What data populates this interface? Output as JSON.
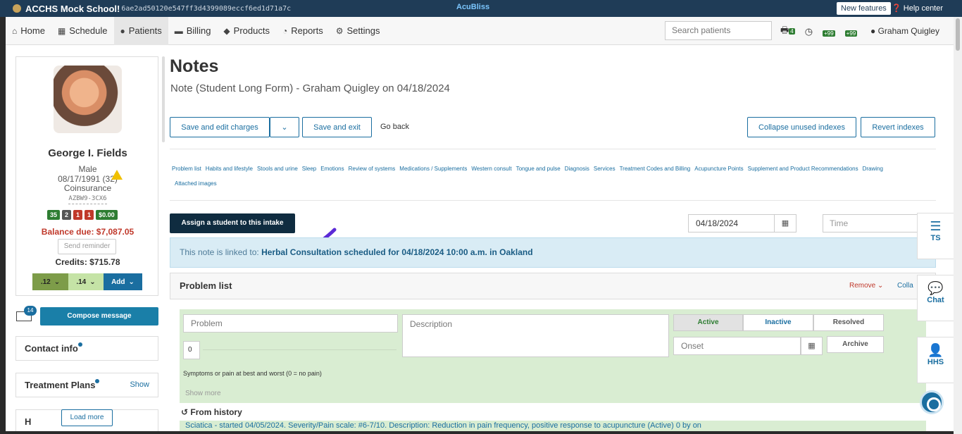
{
  "topbar": {
    "school": "ACCHS Mock School!",
    "hash": "6ae2ad50120e547ff3d4399089eccf6ed1d71a7c",
    "brand": "AcuBliss",
    "new_features": "New features",
    "help_center": "Help center"
  },
  "nav": {
    "items": [
      {
        "label": "Home",
        "icon": "home-icon"
      },
      {
        "label": "Schedule",
        "icon": "calendar-icon"
      },
      {
        "label": "Patients",
        "icon": "user-icon"
      },
      {
        "label": "Billing",
        "icon": "card-icon"
      },
      {
        "label": "Products",
        "icon": "box-icon"
      },
      {
        "label": "Reports",
        "icon": "pie-icon"
      },
      {
        "label": "Settings",
        "icon": "gear-icon"
      }
    ],
    "active": "Patients",
    "search_placeholder": "Search patients",
    "badge_4": "4",
    "badge_99a": "+99",
    "badge_99b": "+99",
    "user": "Graham Quigley"
  },
  "patient": {
    "name": "George I. Fields",
    "sex": "Male",
    "dob": "08/17/1991 (32)",
    "insurance": "Coinsurance",
    "id": "AZBW9-3CX6",
    "counts": [
      {
        "value": "35",
        "color": "#2e7d32"
      },
      {
        "value": "2",
        "color": "#555555"
      },
      {
        "value": "1",
        "color": "#c0392b"
      },
      {
        "value": "1",
        "color": "#c0392b"
      },
      {
        "value": "$0.00",
        "color": "#2e7d32"
      }
    ],
    "balance": "Balance due: $7,087.05",
    "send_reminder": "Send reminder",
    "credits": "Credits: $715.78",
    "code1": ".12",
    "code2": ".14",
    "add": "Add"
  },
  "compose": {
    "badge": "14",
    "label": "Compose message"
  },
  "side_panels": {
    "contact": "Contact info",
    "plans": "Treatment Plans",
    "plans_show": "Show",
    "partial": "H",
    "load_more": "Load more"
  },
  "main": {
    "title": "Notes",
    "subtitle": "Note (Student Long Form) - Graham Quigley on 04/18/2024",
    "save_edit": "Save and edit charges",
    "save_exit": "Save and exit",
    "go_back": "Go back",
    "collapse_unused": "Collapse unused indexes",
    "revert": "Revert indexes",
    "links": [
      "Problem list",
      "Habits and lifestyle",
      "Stools and urine",
      "Sleep",
      "Emotions",
      "Review of systems",
      "Medications / Supplements",
      "Western consult",
      "Tongue and pulse",
      "Diagnosis",
      "Services",
      "Treatment Codes and Billing",
      "Acupuncture Points",
      "Supplement and Product Recommendations",
      "Drawing",
      "Attached images"
    ],
    "assign": "Assign a student to this intake",
    "date": "04/18/2024",
    "time_placeholder": "Time",
    "linked_prefix": "This note is linked to: ",
    "linked_bold": "Herbal Consultation scheduled for 04/18/2024 10:00 a.m. in Oakland"
  },
  "problem": {
    "heading": "Problem list",
    "remove": "Remove",
    "collapse": "Colla",
    "problem_placeholder": "Problem",
    "description_placeholder": "Description",
    "active": "Active",
    "inactive": "Inactive",
    "resolved": "Resolved",
    "onset_placeholder": "Onset",
    "archive": "Archive",
    "pain_value": "0",
    "symptoms": "Symptoms or pain at best and worst (0 = no pain)",
    "show_more": "Show more",
    "from_history": "From history",
    "history_line": "Sciatica - started 04/05/2024. Severity/Pain scale: #6-7/10. Description: Reduction in pain frequency, positive response to acupuncture (Active) 0 by on"
  },
  "widgets": {
    "ts": "TS",
    "chat": "Chat",
    "hhs": "HHS"
  },
  "colors": {
    "brand_blue": "#1a6ea0",
    "dark_button": "#0f2c40",
    "annotation_arrow": "#5b2ad6"
  }
}
